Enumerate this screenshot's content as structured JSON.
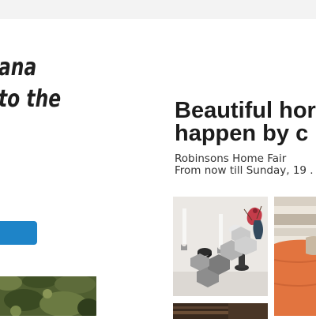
{
  "left_panel": {
    "heading_lines": [
      "ana",
      "to the"
    ],
    "cta_label": ""
  },
  "promo": {
    "heading_lines": [
      "Beautiful hor",
      "happen by c"
    ],
    "event_name": "Robinsons Home Fair",
    "event_date": "From now till Sunday, 19 ."
  },
  "colors": {
    "accent_button": "#1e84c8",
    "heading_text": "#1c1c1c",
    "top_bar": "#f3f3f3"
  }
}
